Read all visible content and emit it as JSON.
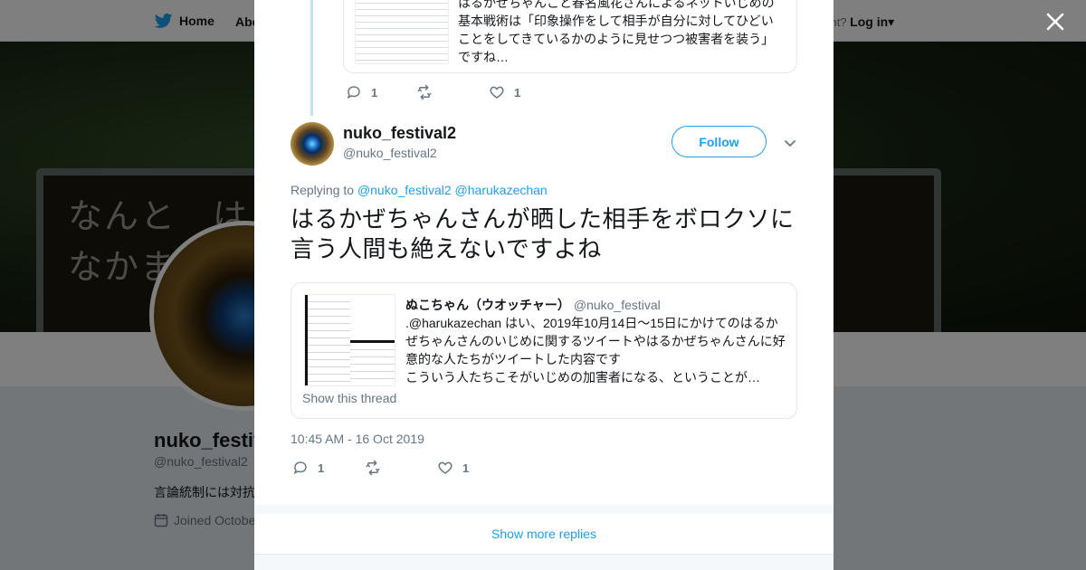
{
  "topnav": {
    "home_label": "Home",
    "about_label": "Abo",
    "account_prompt": "ccount?",
    "login_label": "Log in"
  },
  "banner": {
    "line1": "なんと　は",
    "line2": "なかま"
  },
  "profile": {
    "name": "nuko_festiv",
    "handle": "@nuko_festival2",
    "bio": "言論統制には対抗",
    "joined": "Joined Octobe"
  },
  "previous_tweet": {
    "text": "はるかぜちゃんこと春名風花さんによるネットいじめの基本戦術は「印象操作をして相手が自分に対してひどいことをしてきているかのように見せつつ被害者を装う」ですね…",
    "reply_count": "1",
    "retweet_count": "",
    "like_count": "1"
  },
  "tweet": {
    "author_name": "nuko_festival2",
    "author_handle": "@nuko_festival2",
    "follow_label": "Follow",
    "replying_prefix": "Replying to",
    "replying_user1": "@nuko_festival2",
    "replying_user2": "@harukazechan",
    "text": "はるかぜちゃんさんが晒した相手をボロクソに言う人間も絶えないですよね",
    "timestamp": "10:45 AM - 16 Oct 2019",
    "reply_count": "1",
    "retweet_count": "",
    "like_count": "1"
  },
  "quoted": {
    "author_name": "ぬこちゃん（ウオッチャー）",
    "author_handle": "@nuko_festival",
    "text": ".@harukazechan はい、2019年10月14日～15日にかけてのはるかぜちゃんさんのいじめに関するツイートやはるかぜちゃんさんに好意的な人たちがツイートした内容です\nこういう人たちこそがいじめの加害者になる、ということが…",
    "show_thread_label": "Show this thread"
  },
  "footer": {
    "more_replies_label": "Show more replies"
  },
  "colors": {
    "accent": "#1da1f2",
    "secondary_text": "#657786",
    "primary_text": "#14171a",
    "like": "#657786"
  },
  "icons": [
    "twitter-bird-icon",
    "close-icon",
    "reply-icon",
    "retweet-icon",
    "heart-icon",
    "chevron-down-icon",
    "calendar-icon"
  ]
}
